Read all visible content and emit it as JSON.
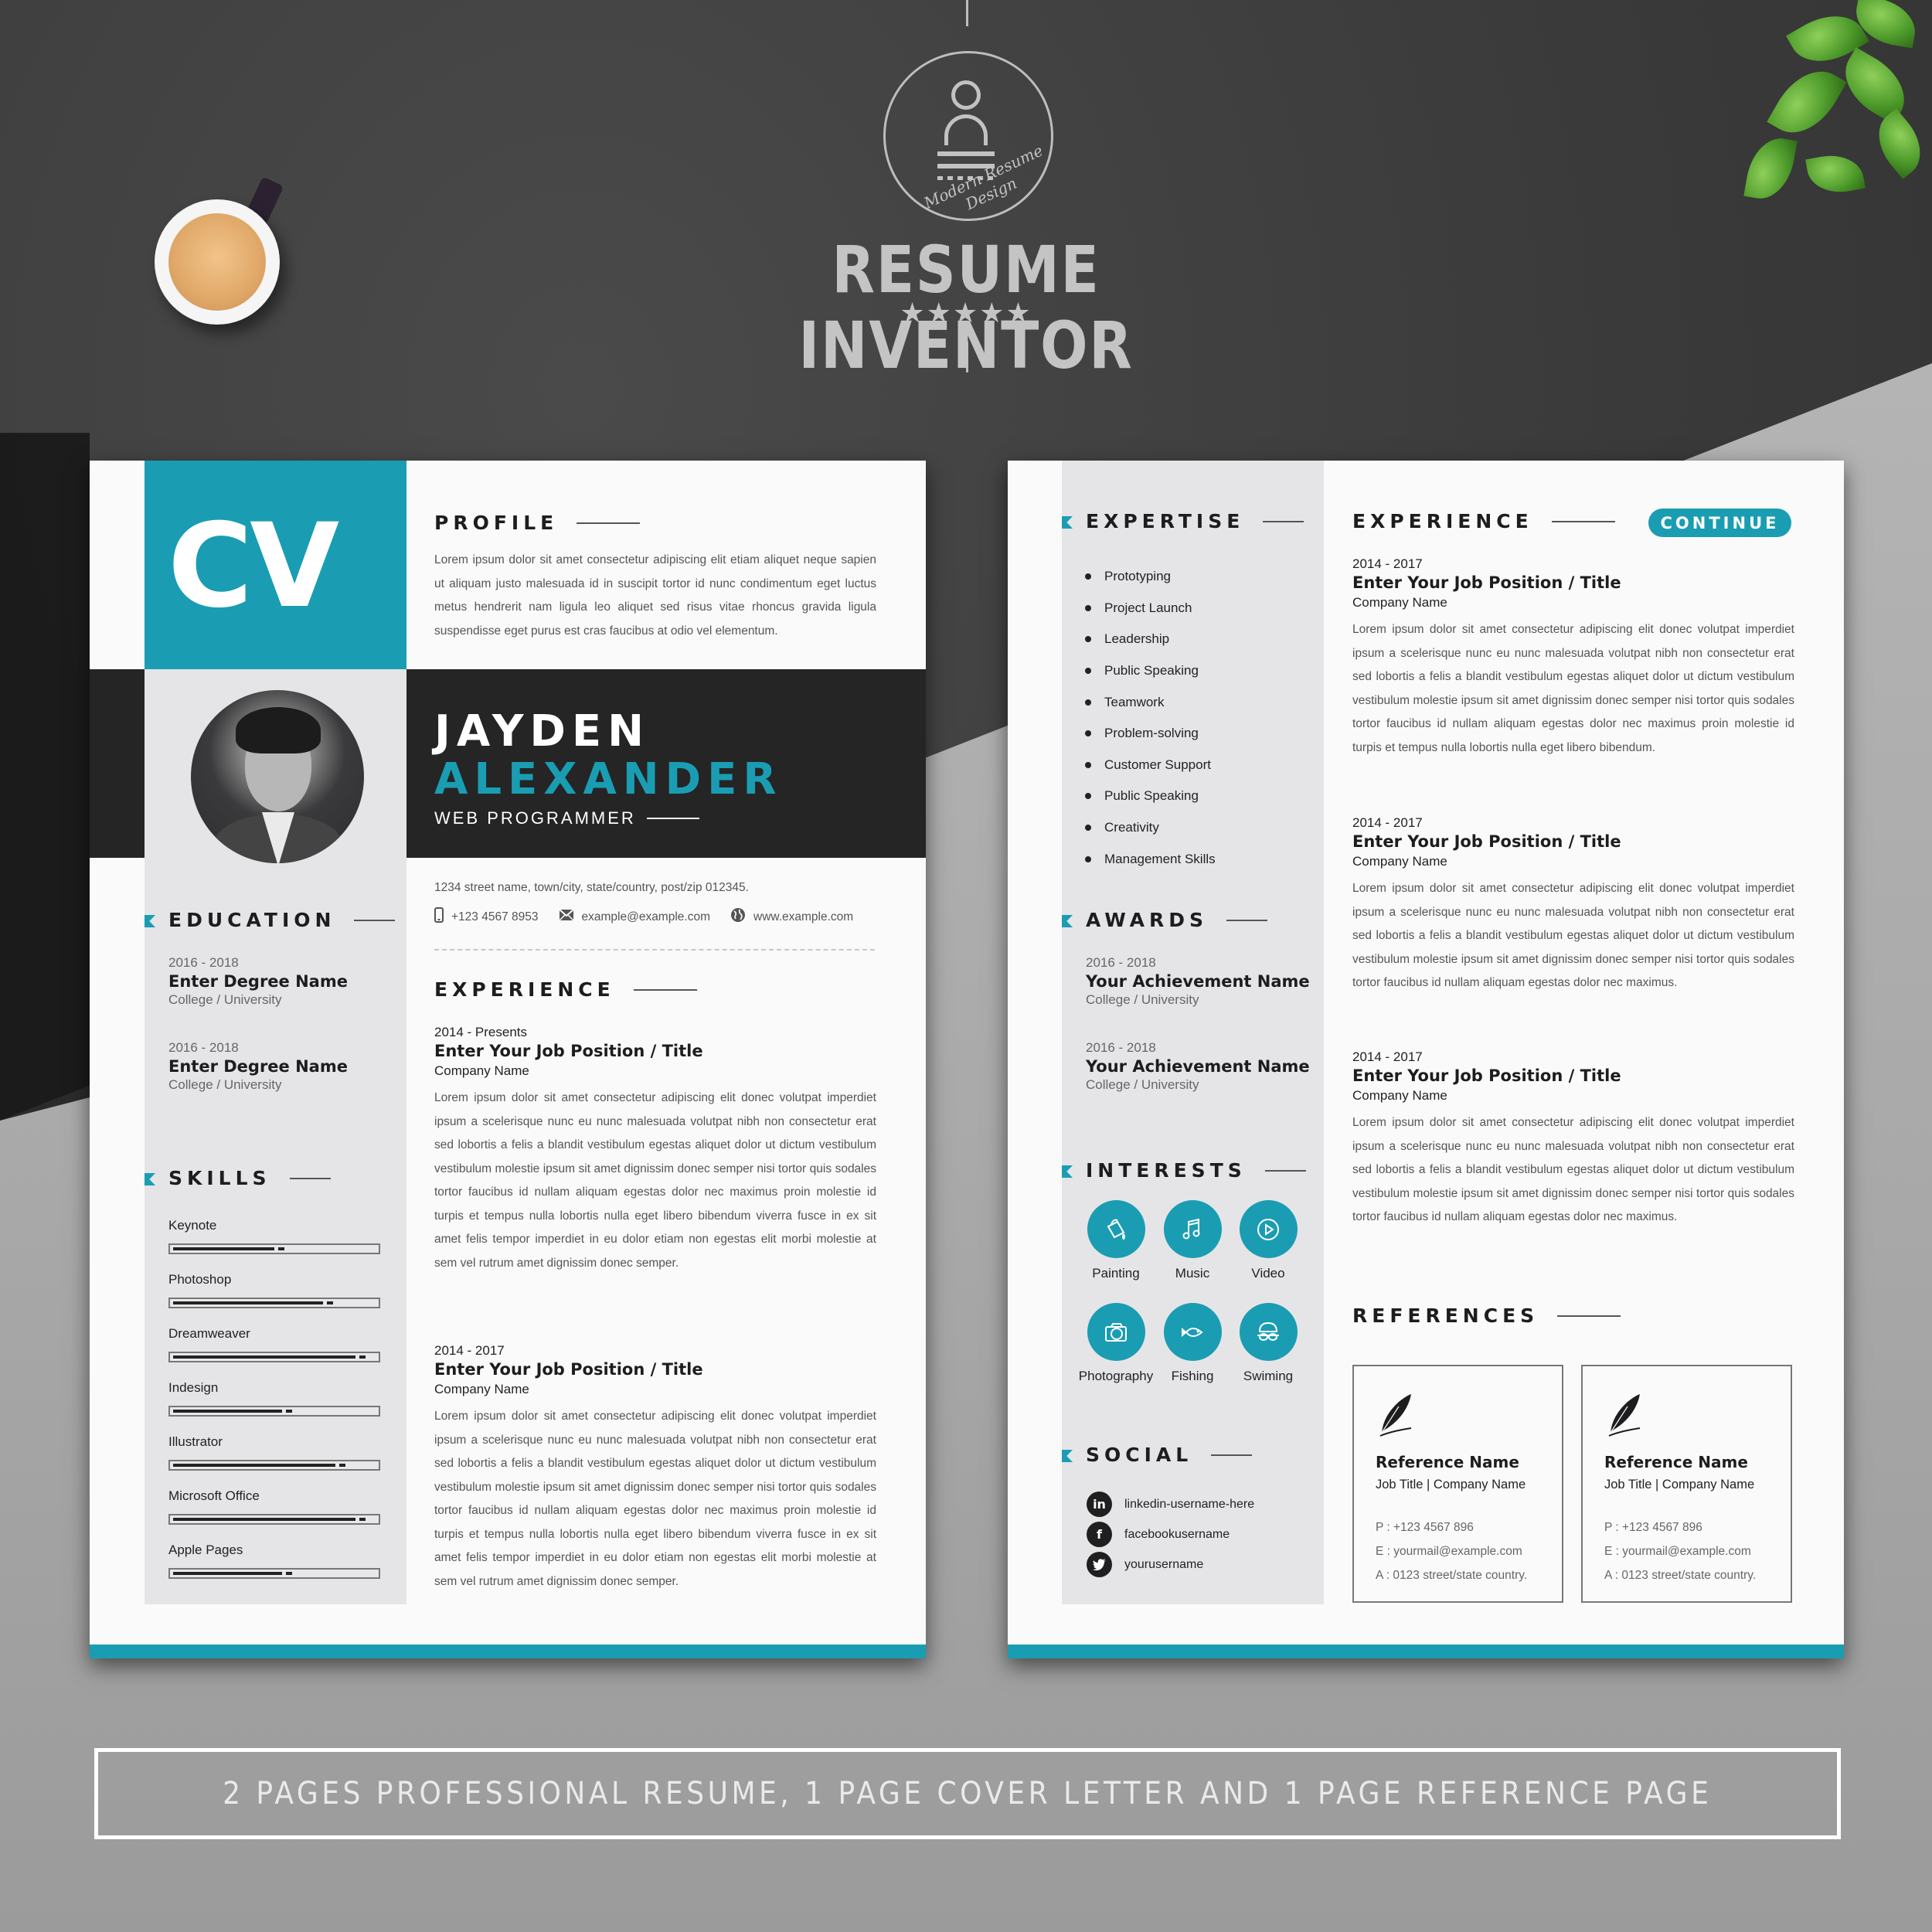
{
  "brand": {
    "name": "RESUME INVENTOR",
    "tagline": "Modern Resume Design",
    "rating_stars": 5,
    "stars_text": "★★★★★"
  },
  "colors": {
    "accent": "#1a9db2",
    "dark_band": "#252526",
    "sidebar": "#e5e5e7",
    "page": "#fafafa",
    "heading": "#1d1d1f"
  },
  "page1": {
    "cv_mark": "CV",
    "profile": {
      "title": "PROFILE",
      "text": "Lorem ipsum dolor sit amet consectetur adipiscing elit etiam aliquet neque sapien ut aliquam justo malesuada id in suscipit tortor id nunc condimentum eget luctus metus hendrerit nam ligula leo aliquet sed risus vitae rhoncus gravida ligula suspendisse eget purus est cras faucibus at odio vel elementum."
    },
    "name_first": "JAYDEN",
    "name_last": "ALEXANDER",
    "job_title": "WEB PROGRAMMER",
    "contact": {
      "address": "1234 street name, town/city, state/country, post/zip 012345.",
      "phone_icon": "mobile-phone-icon",
      "phone": "+123 4567 8953",
      "email_icon": "envelope-icon",
      "email": "example@example.com",
      "web_icon": "globe-icon",
      "website": "www.example.com"
    },
    "education": {
      "title": "EDUCATION",
      "items": [
        {
          "years": "2016 - 2018",
          "degree": "Enter Degree Name",
          "school": "College / University"
        },
        {
          "years": "2016 - 2018",
          "degree": "Enter Degree Name",
          "school": "College / University"
        }
      ]
    },
    "skills": {
      "title": "SKILLS",
      "items": [
        {
          "name": "Keynote",
          "level": 0.5
        },
        {
          "name": "Photoshop",
          "level": 0.74
        },
        {
          "name": "Dreamweaver",
          "level": 0.9
        },
        {
          "name": "Indesign",
          "level": 0.54
        },
        {
          "name": "Illustrator",
          "level": 0.8
        },
        {
          "name": "Microsoft Office",
          "level": 0.9
        },
        {
          "name": "Apple Pages",
          "level": 0.54
        }
      ]
    },
    "experience": {
      "title": "EXPERIENCE",
      "items": [
        {
          "years": "2014 - Presents",
          "role": "Enter Your Job Position / Title",
          "company": "Company Name",
          "text": "Lorem ipsum dolor sit amet consectetur adipiscing elit donec volutpat imperdiet ipsum a scelerisque nunc eu nunc malesuada volutpat nibh non consectetur erat sed lobortis a felis a blandit vestibulum egestas aliquet dolor ut dictum vestibulum vestibulum molestie ipsum sit amet dignissim donec semper nisi tortor quis sodales tortor faucibus id nullam aliquam egestas dolor nec maximus proin molestie id turpis et tempus nulla lobortis nulla eget libero bibendum viverra fusce in ex sit amet felis tempor imperdiet in eu dolor etiam non egestas elit morbi molestie at sem vel rutrum amet dignissim donec semper."
        },
        {
          "years": "2014 - 2017",
          "role": "Enter Your Job Position / Title",
          "company": "Company Name",
          "text": "Lorem ipsum dolor sit amet consectetur adipiscing elit donec volutpat imperdiet ipsum a scelerisque nunc eu nunc malesuada volutpat nibh non consectetur erat sed lobortis a felis a blandit vestibulum egestas aliquet dolor ut dictum vestibulum vestibulum molestie ipsum sit amet dignissim donec semper nisi tortor quis sodales tortor faucibus id nullam aliquam egestas dolor nec maximus proin molestie id turpis et tempus nulla lobortis nulla eget libero bibendum viverra fusce in ex sit amet felis tempor imperdiet in eu dolor etiam non egestas elit morbi molestie at sem vel rutrum amet dignissim donec semper."
        }
      ]
    }
  },
  "page2": {
    "expertise": {
      "title": "EXPERTISE",
      "items": [
        "Prototyping",
        "Project Launch",
        "Leadership",
        "Public Speaking",
        "Teamwork",
        "Problem-solving",
        "Customer Support",
        "Public Speaking",
        "Creativity",
        "Management Skills"
      ]
    },
    "awards": {
      "title": "AWARDS",
      "items": [
        {
          "years": "2016 - 2018",
          "name": "Your Achievement Name",
          "school": "College / University"
        },
        {
          "years": "2016 - 2018",
          "name": "Your Achievement Name",
          "school": "College / University"
        }
      ]
    },
    "interests": {
      "title": "INTERESTS",
      "items": [
        {
          "label": "Painting",
          "icon": "paint-bucket-icon"
        },
        {
          "label": "Music",
          "icon": "music-note-icon"
        },
        {
          "label": "Video",
          "icon": "play-circle-icon"
        },
        {
          "label": "Photography",
          "icon": "camera-icon"
        },
        {
          "label": "Fishing",
          "icon": "fish-icon"
        },
        {
          "label": "Swiming",
          "icon": "swim-goggles-icon"
        }
      ]
    },
    "social": {
      "title": "SOCIAL",
      "items": [
        {
          "icon": "linkedin-icon",
          "glyph": "in",
          "handle": "linkedin-username-here"
        },
        {
          "icon": "facebook-icon",
          "glyph": "f",
          "handle": "facebookusername"
        },
        {
          "icon": "twitter-icon",
          "glyph": "🐦",
          "handle": "yourusername"
        }
      ]
    },
    "experience": {
      "title": "EXPERIENCE",
      "continue_label": "CONTINUE",
      "items": [
        {
          "years": "2014 - 2017",
          "role": "Enter Your Job Position / Title",
          "company": "Company Name",
          "text": "Lorem ipsum dolor sit amet consectetur adipiscing elit donec volutpat imperdiet ipsum a scelerisque nunc eu nunc malesuada volutpat nibh non consectetur erat sed lobortis a felis a blandit vestibulum egestas aliquet dolor ut dictum vestibulum vestibulum molestie ipsum sit amet dignissim donec semper nisi tortor quis sodales tortor faucibus id nullam aliquam egestas dolor nec maximus proin molestie id turpis et tempus nulla lobortis nulla eget libero bibendum."
        },
        {
          "years": "2014 - 2017",
          "role": "Enter Your Job Position / Title",
          "company": "Company Name",
          "text": "Lorem ipsum dolor sit amet consectetur adipiscing elit donec volutpat imperdiet ipsum a scelerisque nunc eu nunc malesuada volutpat nibh non consectetur erat sed lobortis a felis a blandit vestibulum egestas aliquet dolor ut dictum vestibulum vestibulum molestie ipsum sit amet dignissim donec semper nisi tortor quis sodales tortor faucibus id nullam aliquam egestas dolor nec maximus."
        },
        {
          "years": "2014 - 2017",
          "role": "Enter Your Job Position / Title",
          "company": "Company Name",
          "text": "Lorem ipsum dolor sit amet consectetur adipiscing elit donec volutpat imperdiet ipsum a scelerisque nunc eu nunc malesuada volutpat nibh non consectetur erat sed lobortis a felis a blandit vestibulum egestas aliquet dolor ut dictum vestibulum vestibulum molestie ipsum sit amet dignissim donec semper nisi tortor quis sodales tortor faucibus id nullam aliquam egestas dolor nec maximus."
        }
      ]
    },
    "references": {
      "title": "REFERENCES",
      "items": [
        {
          "name": "Reference Name",
          "job": "Job Title | Company Name",
          "phone": "P  :  +123 4567 896",
          "email": "E  :  yourmail@example.com",
          "address": "A  :  0123 street/state country."
        },
        {
          "name": "Reference Name",
          "job": "Job Title | Company Name",
          "phone": "P  :  +123 4567 896",
          "email": "E  :  yourmail@example.com",
          "address": "A  :  0123 street/state country."
        }
      ]
    }
  },
  "banner": {
    "text": "2 PAGES PROFESSIONAL RESUME, 1 PAGE COVER LETTER AND 1 PAGE REFERENCE PAGE"
  }
}
